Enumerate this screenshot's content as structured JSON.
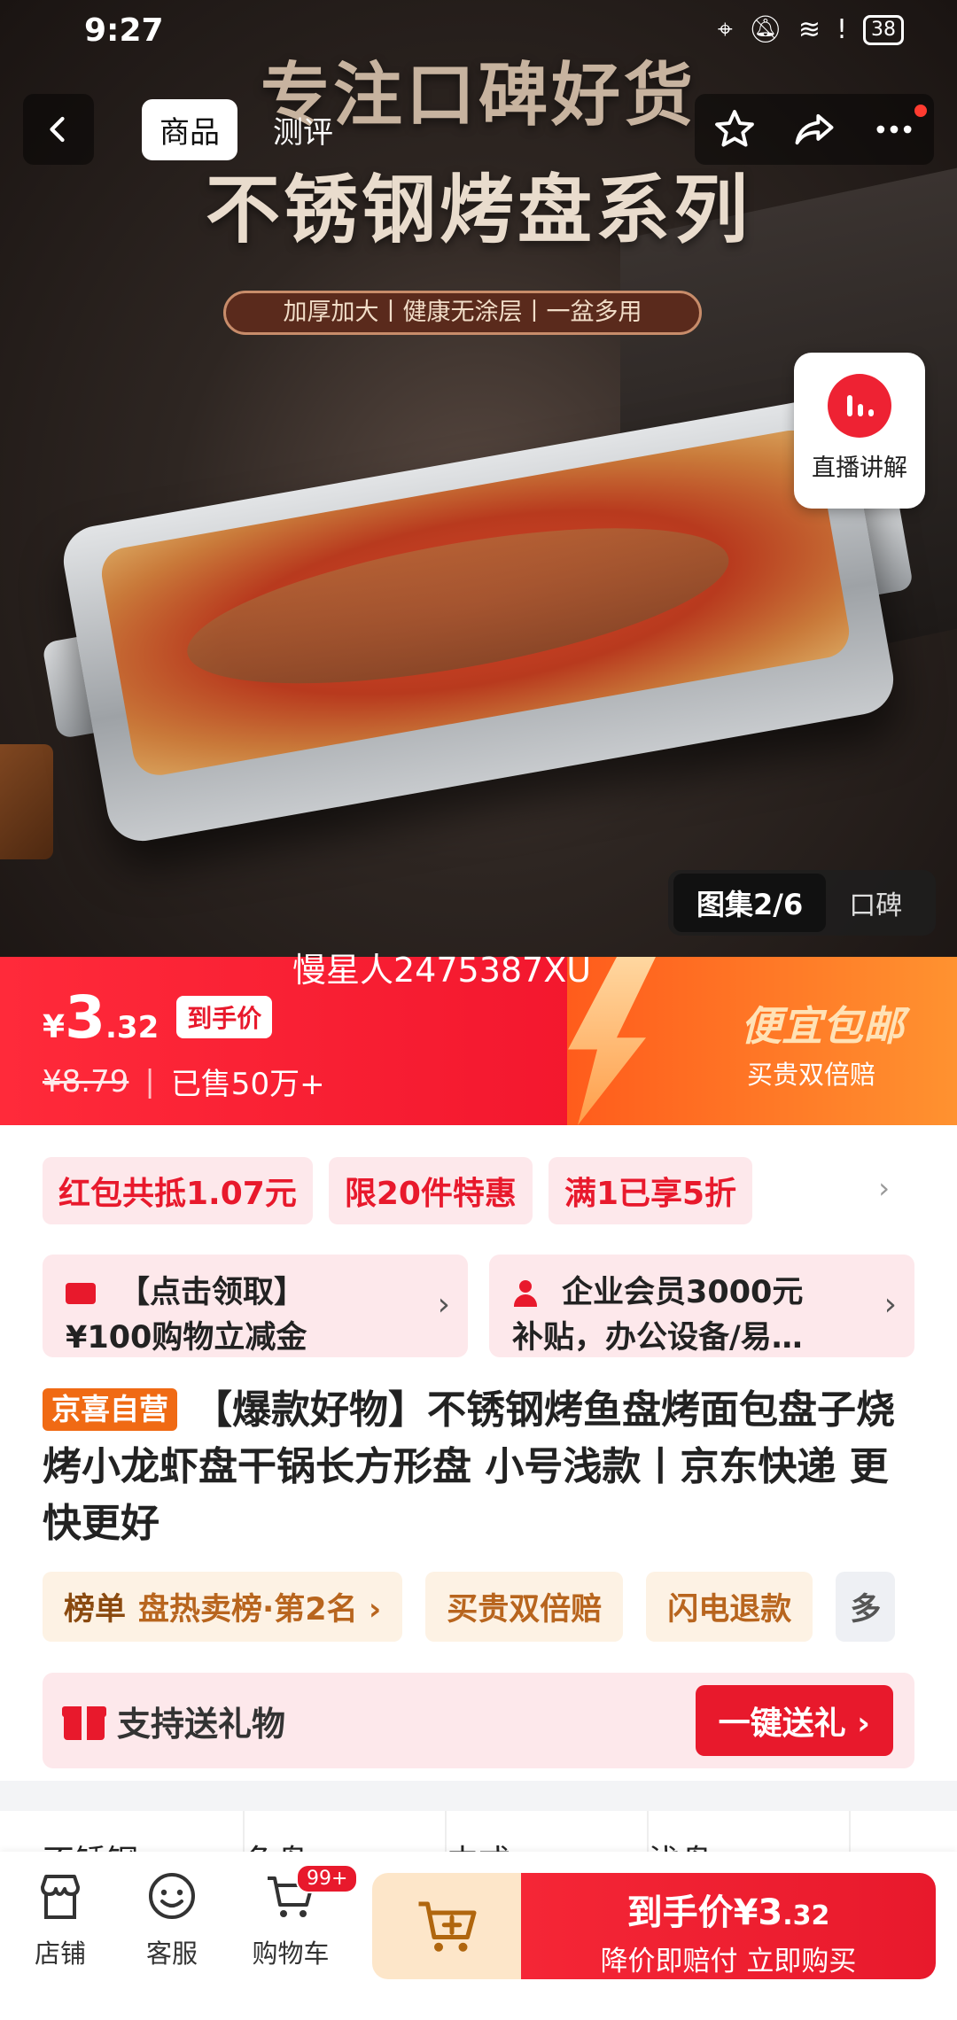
{
  "status_bar": {
    "time": "9:27",
    "battery": "38"
  },
  "nav": {
    "tabs": [
      "商品",
      "测评"
    ]
  },
  "hero": {
    "headline1": "专注口碑好货",
    "headline2": "不锈钢烤盘系列",
    "tagline": "加厚加大丨健康无涂层丨一盆多用",
    "live_label": "直播讲解",
    "gallery_active": "图集2/6",
    "gallery_other": "口碑",
    "watermark": "慢星人2475387XU"
  },
  "price": {
    "currency": "¥",
    "int": "3",
    "dec": ".32",
    "tag": "到手价",
    "original": "¥8.79",
    "sold": "已售50万+",
    "promo_title": "便宜包邮",
    "promo_sub": "买贵双倍赔"
  },
  "coupons": [
    "红包共抵1.07元",
    "限20件特惠",
    "满1已享5折"
  ],
  "benefits": [
    {
      "line1": "【点击领取】",
      "line2": "¥100购物立减金"
    },
    {
      "line1": "企业会员3000元",
      "line2": "补贴，办公设备/易…"
    }
  ],
  "product": {
    "badge": "京喜自营",
    "title": "【爆款好物】不锈钢烤鱼盘烤面包盘子烧烤小龙虾盘干锅长方形盘 小号浅款丨京东快递 更快更好"
  },
  "tags": {
    "rank_label": "榜单",
    "rank_value": "盘热卖榜·第2名 ›",
    "items": [
      "买贵双倍赔",
      "闪电退款",
      "多"
    ]
  },
  "gift": {
    "text": "支持送礼物",
    "button": "一键送礼 ›"
  },
  "specs": [
    "不锈钢",
    "鱼盘",
    "中式",
    "浅盘"
  ],
  "bottom": {
    "store": "店铺",
    "service": "客服",
    "cart": "购物车",
    "cart_badge": "99+",
    "buy_line1_prefix": "到手价¥3",
    "buy_line1_dec": ".32",
    "buy_line2": "降价即赔付 立即购买"
  },
  "colors": {
    "accent": "#e8192c",
    "badge_orange": "#f06a14"
  }
}
